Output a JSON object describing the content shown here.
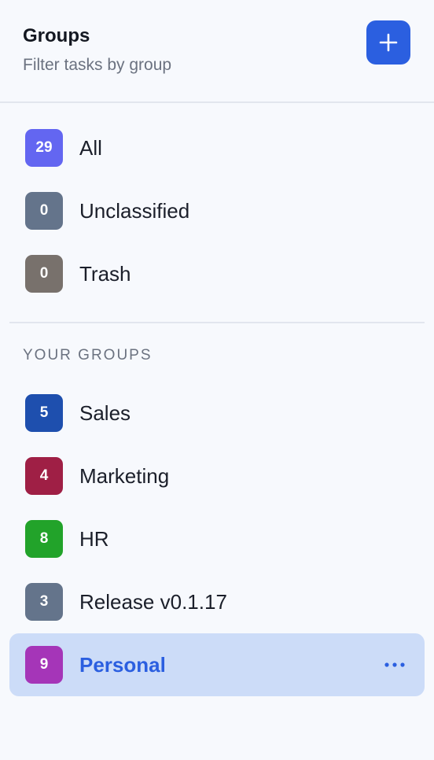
{
  "header": {
    "title": "Groups",
    "subtitle": "Filter tasks by group",
    "add_icon": "plus-icon",
    "accent": "#2b5fe0"
  },
  "system_groups": [
    {
      "count": "29",
      "label": "All",
      "color": "#6366f1"
    },
    {
      "count": "0",
      "label": "Unclassified",
      "color": "#64748b"
    },
    {
      "count": "0",
      "label": "Trash",
      "color": "#78716c"
    }
  ],
  "section_title": "YOUR GROUPS",
  "groups": [
    {
      "count": "5",
      "label": "Sales",
      "color": "#1e4fae"
    },
    {
      "count": "4",
      "label": "Marketing",
      "color": "#9f1f45"
    },
    {
      "count": "8",
      "label": "HR",
      "color": "#22a32a"
    },
    {
      "count": "3",
      "label": "Release v0.1.17",
      "color": "#64748b"
    },
    {
      "count": "9",
      "label": "Personal",
      "color": "#a535b8",
      "active": true,
      "more_icon": "more-horizontal-icon"
    }
  ]
}
